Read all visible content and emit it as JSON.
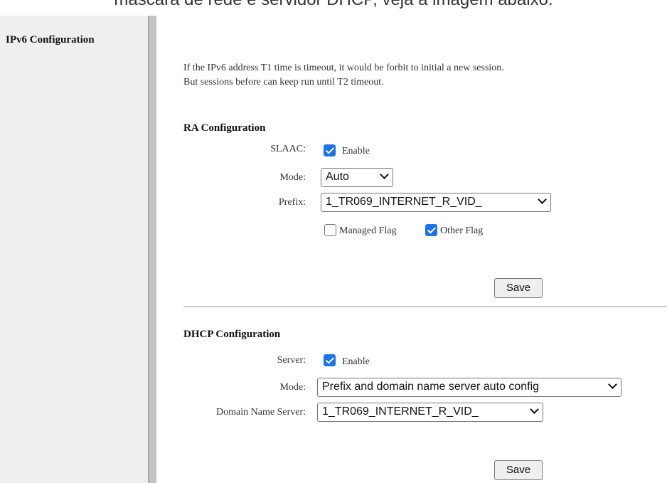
{
  "caption": "máscara de rede e servidor DHCP, veja a imagem abaixo.",
  "sidebar": {
    "title": "IPv6 Configuration"
  },
  "note": {
    "line1": "If the IPv6 address T1 time is timeout, it would be forbit to initial a new session.",
    "line2": "But sessions before can keep run until T2 timeout."
  },
  "ra": {
    "title": "RA Configuration",
    "slaac_label": "SLAAC:",
    "slaac_enable_checked": true,
    "slaac_enable_text": "Enable",
    "mode_label": "Mode:",
    "mode_value": "Auto",
    "prefix_label": "Prefix:",
    "prefix_value": "1_TR069_INTERNET_R_VID_",
    "managed_flag_checked": false,
    "managed_flag_text": "Managed Flag",
    "other_flag_checked": true,
    "other_flag_text": "Other Flag",
    "save_label": "Save"
  },
  "dhcp": {
    "title": "DHCP Configuration",
    "server_label": "Server:",
    "server_enable_checked": true,
    "server_enable_text": "Enable",
    "mode_label": "Mode:",
    "mode_value": "Prefix and domain name server auto config",
    "dns_label": "Domain Name Server:",
    "dns_value": "1_TR069_INTERNET_R_VID_",
    "save_label": "Save"
  },
  "colors": {
    "checkbox_accent": "#1a73e8",
    "sidebar_bg": "#efefef",
    "divider": "#c4c4c4"
  },
  "icons": {
    "checkbox_checked": "check-icon",
    "select_arrow": "chevron-down-icon"
  }
}
